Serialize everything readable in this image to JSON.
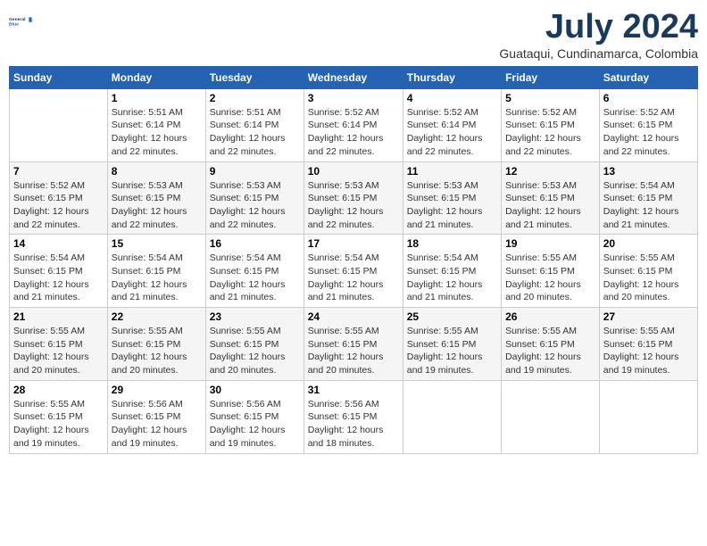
{
  "header": {
    "logo_line1": "General",
    "logo_line2": "Blue",
    "month_title": "July 2024",
    "subtitle": "Guataqui, Cundinamarca, Colombia"
  },
  "days_of_week": [
    "Sunday",
    "Monday",
    "Tuesday",
    "Wednesday",
    "Thursday",
    "Friday",
    "Saturday"
  ],
  "weeks": [
    [
      {
        "day": "",
        "info": ""
      },
      {
        "day": "1",
        "info": "Sunrise: 5:51 AM\nSunset: 6:14 PM\nDaylight: 12 hours\nand 22 minutes."
      },
      {
        "day": "2",
        "info": "Sunrise: 5:51 AM\nSunset: 6:14 PM\nDaylight: 12 hours\nand 22 minutes."
      },
      {
        "day": "3",
        "info": "Sunrise: 5:52 AM\nSunset: 6:14 PM\nDaylight: 12 hours\nand 22 minutes."
      },
      {
        "day": "4",
        "info": "Sunrise: 5:52 AM\nSunset: 6:14 PM\nDaylight: 12 hours\nand 22 minutes."
      },
      {
        "day": "5",
        "info": "Sunrise: 5:52 AM\nSunset: 6:15 PM\nDaylight: 12 hours\nand 22 minutes."
      },
      {
        "day": "6",
        "info": "Sunrise: 5:52 AM\nSunset: 6:15 PM\nDaylight: 12 hours\nand 22 minutes."
      }
    ],
    [
      {
        "day": "7",
        "info": "Sunrise: 5:52 AM\nSunset: 6:15 PM\nDaylight: 12 hours\nand 22 minutes."
      },
      {
        "day": "8",
        "info": "Sunrise: 5:53 AM\nSunset: 6:15 PM\nDaylight: 12 hours\nand 22 minutes."
      },
      {
        "day": "9",
        "info": "Sunrise: 5:53 AM\nSunset: 6:15 PM\nDaylight: 12 hours\nand 22 minutes."
      },
      {
        "day": "10",
        "info": "Sunrise: 5:53 AM\nSunset: 6:15 PM\nDaylight: 12 hours\nand 22 minutes."
      },
      {
        "day": "11",
        "info": "Sunrise: 5:53 AM\nSunset: 6:15 PM\nDaylight: 12 hours\nand 21 minutes."
      },
      {
        "day": "12",
        "info": "Sunrise: 5:53 AM\nSunset: 6:15 PM\nDaylight: 12 hours\nand 21 minutes."
      },
      {
        "day": "13",
        "info": "Sunrise: 5:54 AM\nSunset: 6:15 PM\nDaylight: 12 hours\nand 21 minutes."
      }
    ],
    [
      {
        "day": "14",
        "info": "Sunrise: 5:54 AM\nSunset: 6:15 PM\nDaylight: 12 hours\nand 21 minutes."
      },
      {
        "day": "15",
        "info": "Sunrise: 5:54 AM\nSunset: 6:15 PM\nDaylight: 12 hours\nand 21 minutes."
      },
      {
        "day": "16",
        "info": "Sunrise: 5:54 AM\nSunset: 6:15 PM\nDaylight: 12 hours\nand 21 minutes."
      },
      {
        "day": "17",
        "info": "Sunrise: 5:54 AM\nSunset: 6:15 PM\nDaylight: 12 hours\nand 21 minutes."
      },
      {
        "day": "18",
        "info": "Sunrise: 5:54 AM\nSunset: 6:15 PM\nDaylight: 12 hours\nand 21 minutes."
      },
      {
        "day": "19",
        "info": "Sunrise: 5:55 AM\nSunset: 6:15 PM\nDaylight: 12 hours\nand 20 minutes."
      },
      {
        "day": "20",
        "info": "Sunrise: 5:55 AM\nSunset: 6:15 PM\nDaylight: 12 hours\nand 20 minutes."
      }
    ],
    [
      {
        "day": "21",
        "info": "Sunrise: 5:55 AM\nSunset: 6:15 PM\nDaylight: 12 hours\nand 20 minutes."
      },
      {
        "day": "22",
        "info": "Sunrise: 5:55 AM\nSunset: 6:15 PM\nDaylight: 12 hours\nand 20 minutes."
      },
      {
        "day": "23",
        "info": "Sunrise: 5:55 AM\nSunset: 6:15 PM\nDaylight: 12 hours\nand 20 minutes."
      },
      {
        "day": "24",
        "info": "Sunrise: 5:55 AM\nSunset: 6:15 PM\nDaylight: 12 hours\nand 20 minutes."
      },
      {
        "day": "25",
        "info": "Sunrise: 5:55 AM\nSunset: 6:15 PM\nDaylight: 12 hours\nand 19 minutes."
      },
      {
        "day": "26",
        "info": "Sunrise: 5:55 AM\nSunset: 6:15 PM\nDaylight: 12 hours\nand 19 minutes."
      },
      {
        "day": "27",
        "info": "Sunrise: 5:55 AM\nSunset: 6:15 PM\nDaylight: 12 hours\nand 19 minutes."
      }
    ],
    [
      {
        "day": "28",
        "info": "Sunrise: 5:55 AM\nSunset: 6:15 PM\nDaylight: 12 hours\nand 19 minutes."
      },
      {
        "day": "29",
        "info": "Sunrise: 5:56 AM\nSunset: 6:15 PM\nDaylight: 12 hours\nand 19 minutes."
      },
      {
        "day": "30",
        "info": "Sunrise: 5:56 AM\nSunset: 6:15 PM\nDaylight: 12 hours\nand 19 minutes."
      },
      {
        "day": "31",
        "info": "Sunrise: 5:56 AM\nSunset: 6:15 PM\nDaylight: 12 hours\nand 18 minutes."
      },
      {
        "day": "",
        "info": ""
      },
      {
        "day": "",
        "info": ""
      },
      {
        "day": "",
        "info": ""
      }
    ]
  ]
}
